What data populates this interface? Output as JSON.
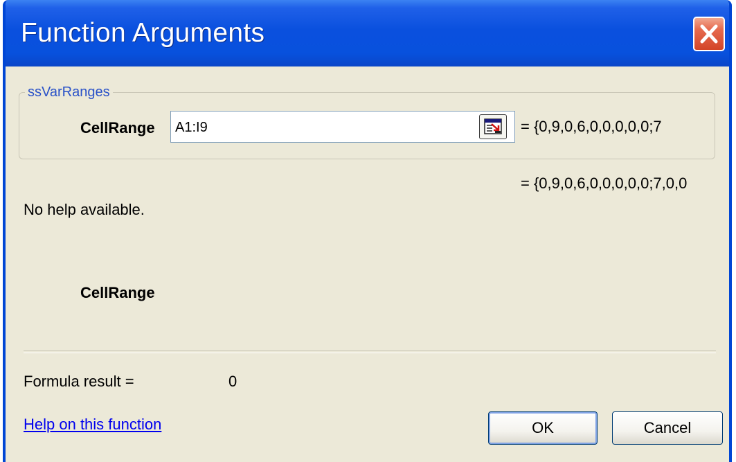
{
  "window": {
    "title": "Function Arguments",
    "close_icon": "close-icon"
  },
  "group": {
    "legend": "ssVarRanges",
    "argument": {
      "label": "CellRange",
      "value": "A1:I9",
      "evaluated": "= {0,9,0,6,0,0,0,0,0;7"
    }
  },
  "result_preview": "= {0,9,0,6,0,0,0,0,0;7,0,0",
  "description": "No help available.",
  "argument_detail": {
    "name": "CellRange",
    "description": ""
  },
  "formula_result": {
    "label": "Formula result =",
    "value": "0"
  },
  "help_link": "Help on this function",
  "buttons": {
    "ok": "OK",
    "cancel": "Cancel"
  },
  "colors": {
    "titlebar": "#0a50de",
    "dialog_bg": "#ece9d8",
    "close_button": "#e66b4f",
    "link": "#0000ee",
    "legend": "#2a52c8"
  }
}
